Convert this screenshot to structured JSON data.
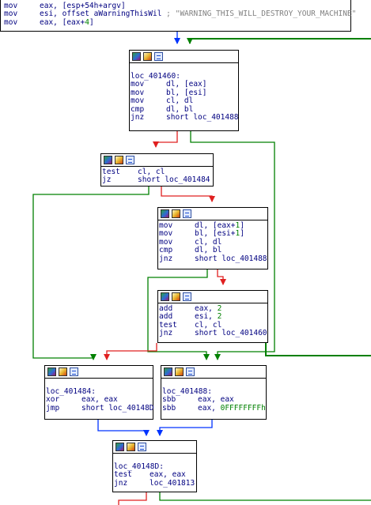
{
  "top_block": {
    "lines": [
      {
        "mn": "mov",
        "op": "eax, [esp+54h+argv]"
      },
      {
        "mn": "mov",
        "op": "esi, offset aWarningThisWil",
        "cmt": "; \"WARNING_THIS_WILL_DESTROY_YOUR_MACHINE\""
      },
      {
        "mn": "mov",
        "op": "eax, [eax+4]"
      }
    ]
  },
  "nodes": {
    "loc_401460": {
      "label": "loc_401460:",
      "lines": [
        {
          "mn": "mov",
          "op": "dl, [eax]"
        },
        {
          "mn": "mov",
          "op": "bl, [esi]"
        },
        {
          "mn": "mov",
          "op": "cl, dl"
        },
        {
          "mn": "cmp",
          "op": "dl, bl"
        },
        {
          "mn": "jnz",
          "op": "short loc_401488"
        }
      ]
    },
    "test_block": {
      "lines": [
        {
          "mn": "test",
          "op": "cl, cl"
        },
        {
          "mn": "jz",
          "op": "short loc_401484"
        }
      ]
    },
    "mov2_block": {
      "lines": [
        {
          "mn": "mov",
          "op": "dl, [eax+1]"
        },
        {
          "mn": "mov",
          "op": "bl, [esi+1]"
        },
        {
          "mn": "mov",
          "op": "cl, dl"
        },
        {
          "mn": "cmp",
          "op": "dl, bl"
        },
        {
          "mn": "jnz",
          "op": "short loc_401488"
        }
      ]
    },
    "add_block": {
      "lines": [
        {
          "mn": "add",
          "op": "eax, 2"
        },
        {
          "mn": "add",
          "op": "esi, 2"
        },
        {
          "mn": "test",
          "op": "cl, cl"
        },
        {
          "mn": "jnz",
          "op": "short loc_401460"
        }
      ]
    },
    "loc_401484": {
      "label": "loc_401484:",
      "lines": [
        {
          "mn": "xor",
          "op": "eax, eax"
        },
        {
          "mn": "jmp",
          "op": "short loc_40148D"
        }
      ]
    },
    "loc_401488": {
      "label": "loc_401488:",
      "lines": [
        {
          "mn": "sbb",
          "op": "eax, eax"
        },
        {
          "mn": "sbb",
          "op": "eax, 0FFFFFFFFh"
        }
      ]
    },
    "loc_40148D": {
      "label": "loc_40148D:",
      "lines": [
        {
          "mn": "test",
          "op": "eax, eax"
        },
        {
          "mn": "jnz",
          "op": "loc_401813"
        }
      ]
    }
  },
  "colors": {
    "edge_true": "#008000",
    "edge_false": "#e02020",
    "edge_uncond": "#0033ff",
    "instr_text": "#000080",
    "numeric": "#008000",
    "comment": "#808080"
  }
}
